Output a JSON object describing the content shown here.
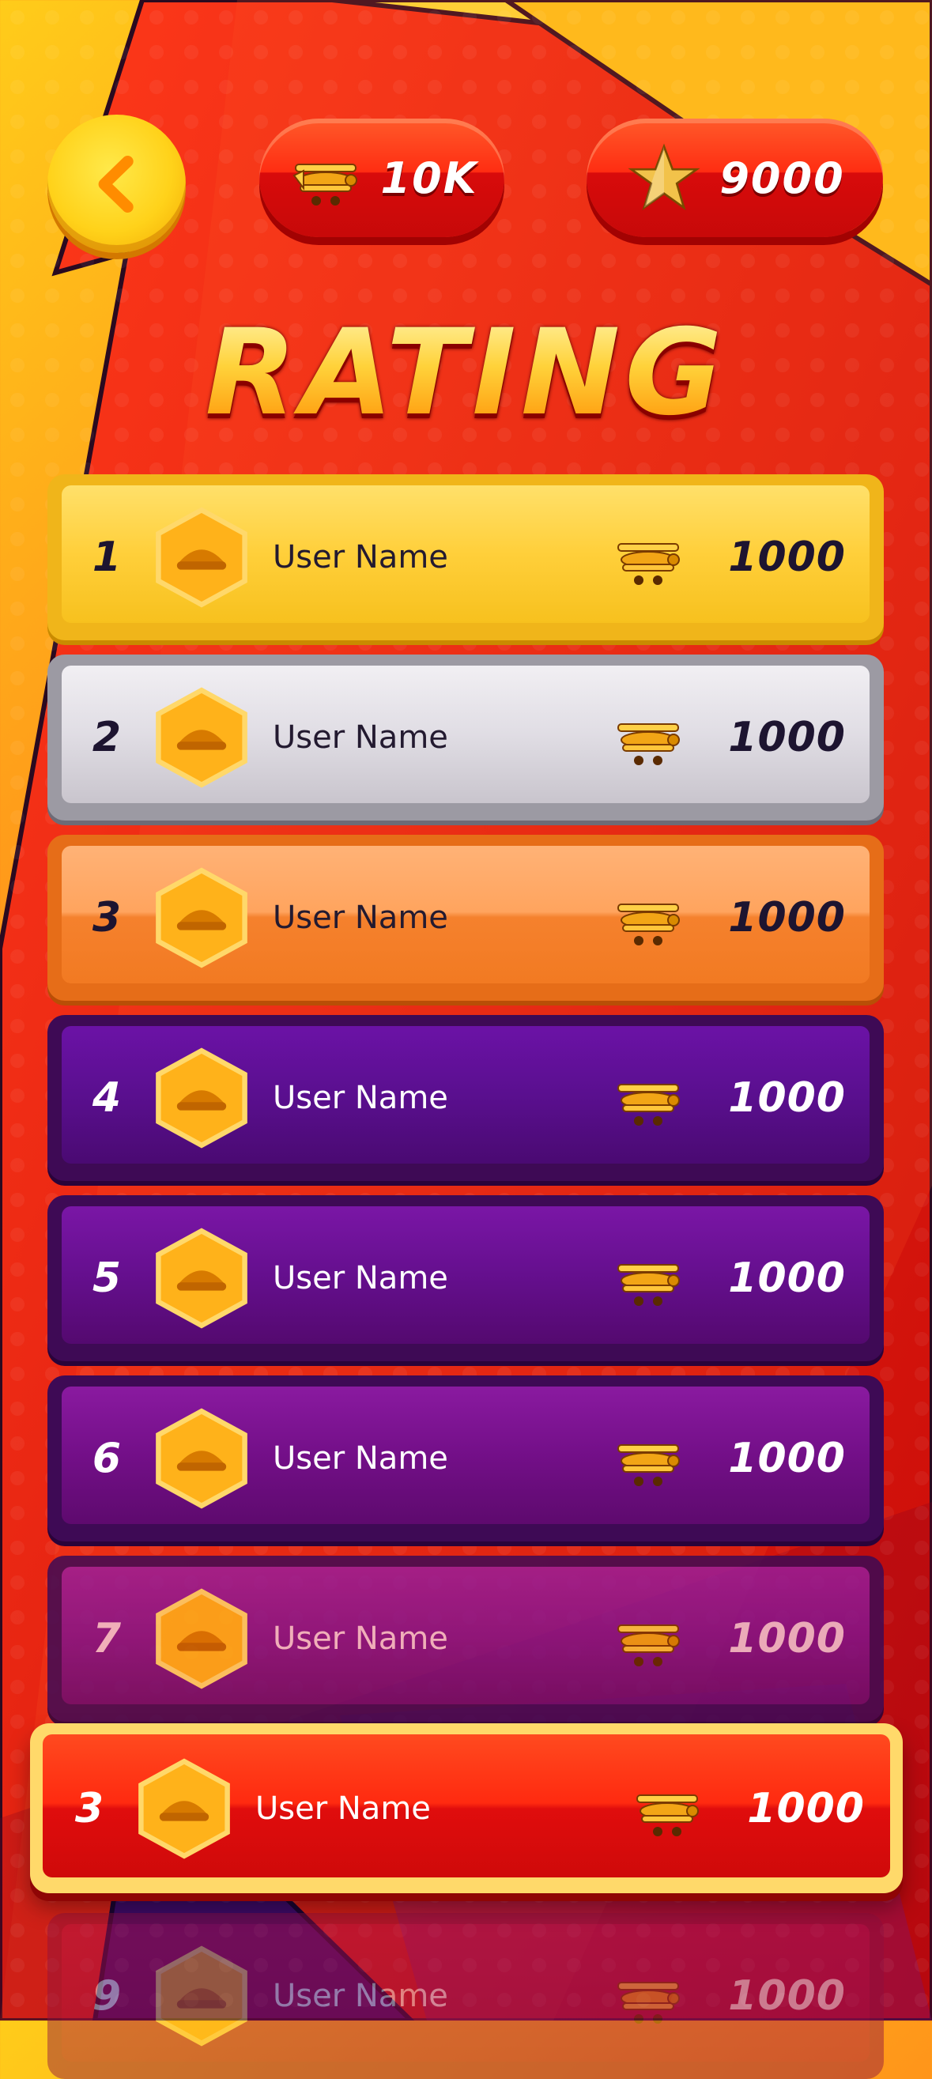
{
  "header": {
    "back_button": "back",
    "planes_balance": "10K",
    "stars_balance": "9000"
  },
  "title": "RATING",
  "leaderboard": [
    {
      "rank": "1",
      "name": "User Name",
      "score": "1000",
      "tier": "gold"
    },
    {
      "rank": "2",
      "name": "User Name",
      "score": "1000",
      "tier": "silver"
    },
    {
      "rank": "3",
      "name": "User Name",
      "score": "1000",
      "tier": "bronze"
    },
    {
      "rank": "4",
      "name": "User Name",
      "score": "1000",
      "tier": "purple"
    },
    {
      "rank": "5",
      "name": "User Name",
      "score": "1000",
      "tier": "purple"
    },
    {
      "rank": "6",
      "name": "User Name",
      "score": "1000",
      "tier": "purple"
    },
    {
      "rank": "7",
      "name": "User Name",
      "score": "1000",
      "tier": "purple"
    },
    {
      "rank": "9",
      "name": "User Name",
      "score": "1000",
      "tier": "faded"
    }
  ],
  "current_user": {
    "rank": "3",
    "name": "User Name",
    "score": "1000"
  },
  "colors": {
    "gold": "#ffcf3a",
    "silver": "#e0dde4",
    "bronze": "#ffa45e",
    "purple": "#5a0f8f",
    "highlight": "#ff2a10",
    "accent_yellow": "#ffd21a"
  },
  "icons": [
    "chevron-left-icon",
    "biplane-icon",
    "star-icon",
    "pilot-cap-avatar-icon"
  ]
}
